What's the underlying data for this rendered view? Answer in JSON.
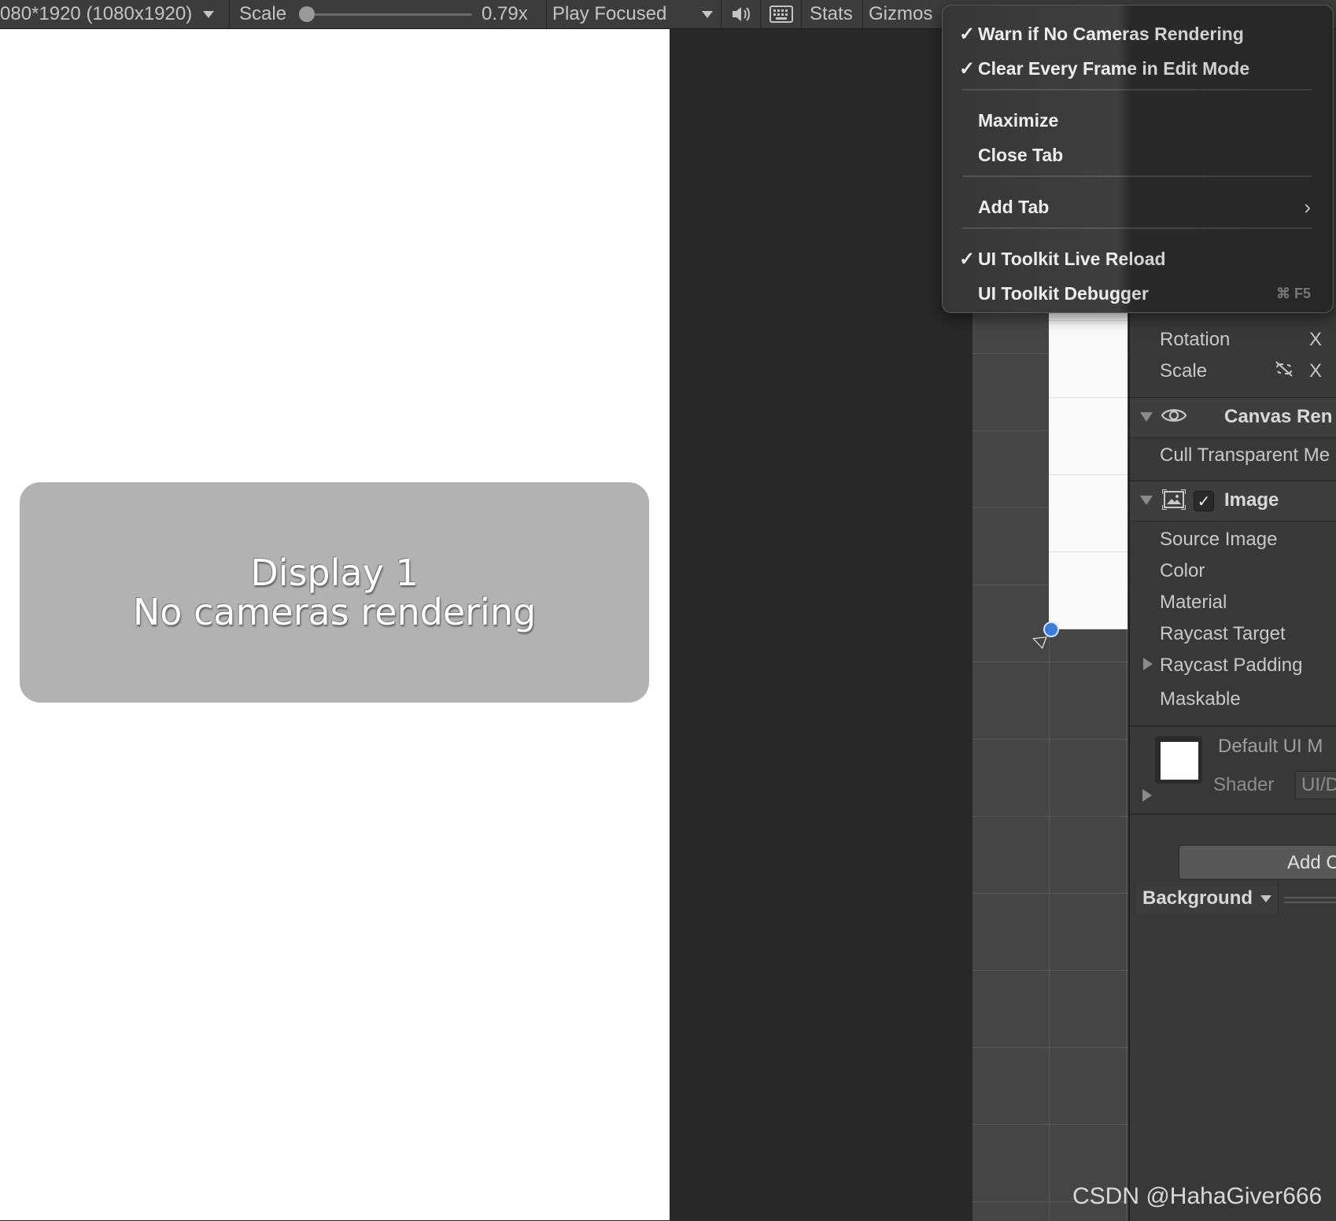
{
  "toolbar": {
    "resolution_label": "080*1920 (1080x1920)",
    "scale_label": "Scale",
    "scale_value": "0.79x",
    "play_focused_label": "Play Focused",
    "mute_icon": "speaker-icon",
    "keyboard_icon": "keyboard-icon",
    "stats_label": "Stats",
    "gizmos_label": "Gizmos"
  },
  "game_view": {
    "line1": "Display 1",
    "line2": "No cameras rendering"
  },
  "context_menu": {
    "items": [
      {
        "label": "Warn if No Cameras Rendering",
        "checked": true
      },
      {
        "label": "Clear Every Frame in Edit Mode",
        "checked": true
      },
      {
        "label": "Maximize",
        "checked": false
      },
      {
        "label": "Close Tab",
        "checked": false
      },
      {
        "label": "Add Tab",
        "checked": false,
        "submenu": true
      },
      {
        "label": "UI Toolkit Live Reload",
        "checked": true
      },
      {
        "label": "UI Toolkit Debugger",
        "checked": false,
        "shortcut": "⌘ F5"
      }
    ],
    "check_glyph": "✓",
    "submenu_glyph": "›"
  },
  "inspector": {
    "rotation_label": "Rotation",
    "rotation_axis": "X",
    "scale_label": "Scale",
    "scale_axis": "X",
    "canvas_renderer_title": "Canvas Ren",
    "cull_transparent_label": "Cull Transparent Me",
    "image_title": "Image",
    "source_image_label": "Source Image",
    "color_label": "Color",
    "material_label": "Material",
    "raycast_target_label": "Raycast Target",
    "raycast_padding_label": "Raycast Padding",
    "maskable_label": "Maskable",
    "material_name": "Default UI M",
    "shader_label": "Shader",
    "shader_value": "UI/D",
    "add_component_label": "Add C",
    "background_label": "Background"
  },
  "watermark": "CSDN @HahaGiver666"
}
